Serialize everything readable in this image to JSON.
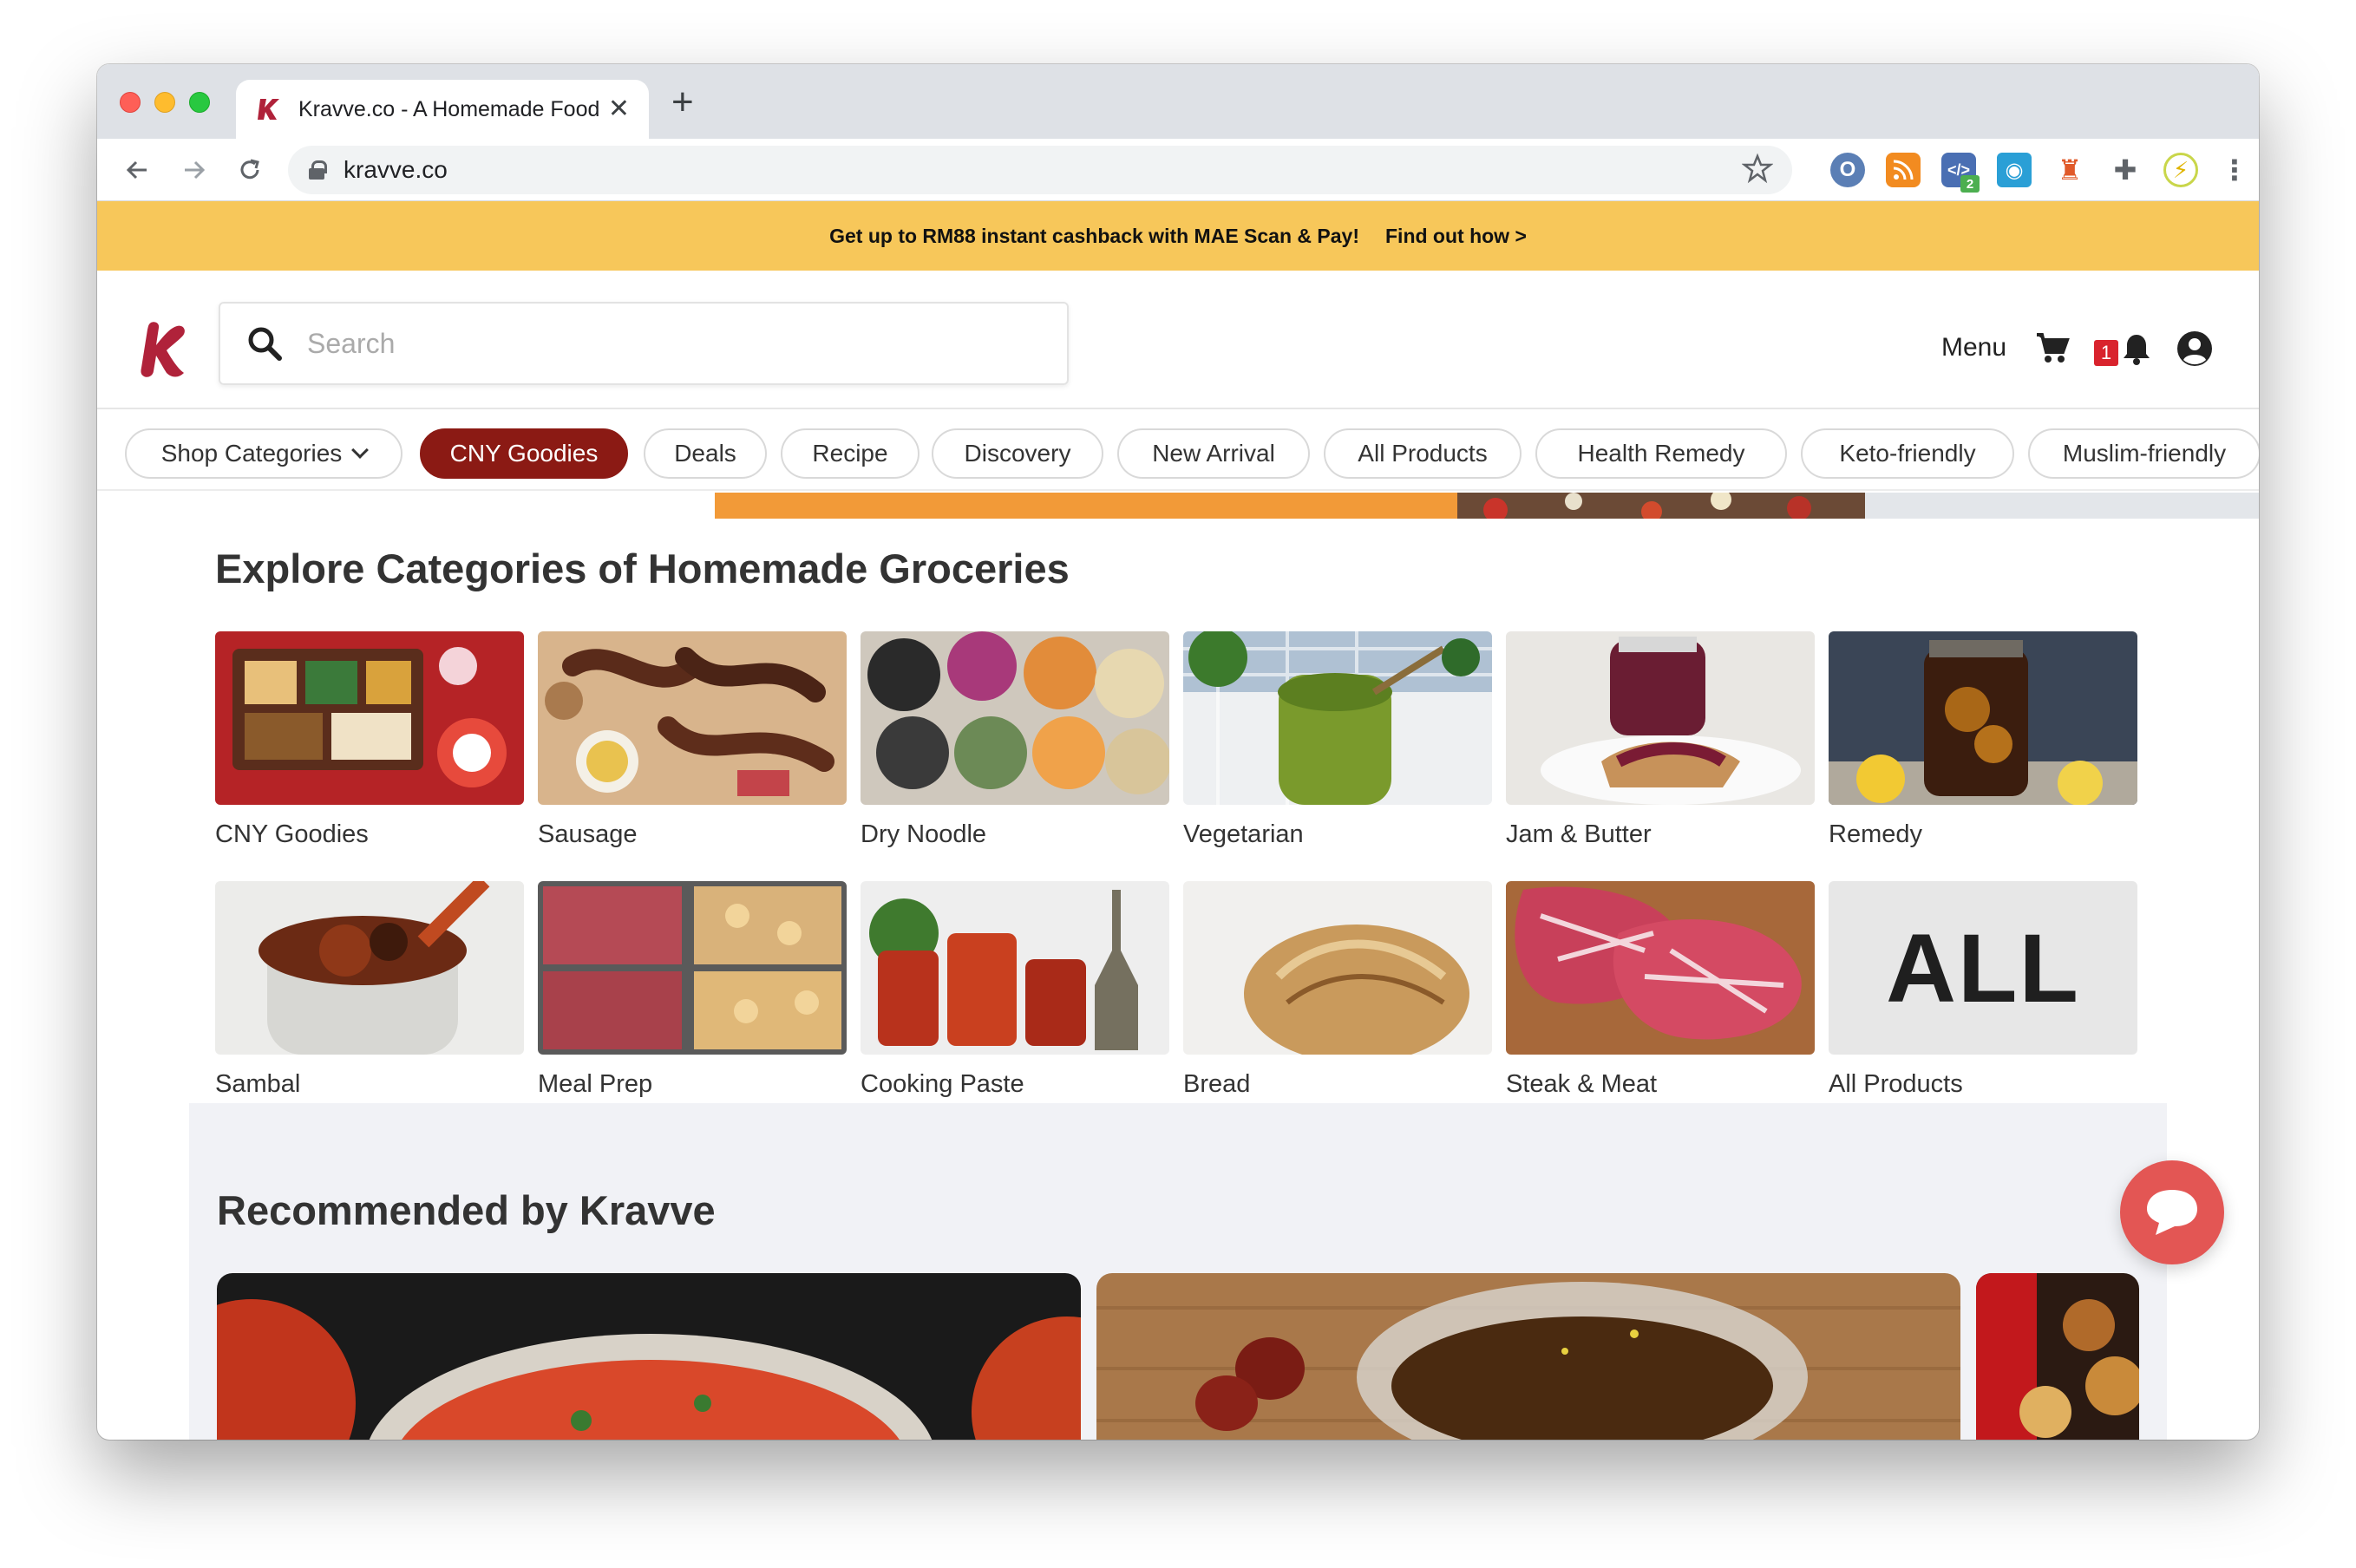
{
  "browser": {
    "tab_title": "Kravve.co - A Homemade Food",
    "tab_close": "✕",
    "new_tab": "+",
    "url": "kravve.co",
    "extension_badge": "2"
  },
  "promo": {
    "text": "Get up to RM88 instant cashback with MAE Scan & Pay!",
    "link": "Find out how >"
  },
  "header": {
    "search_placeholder": "Search",
    "menu_label": "Menu",
    "notification_count": "1"
  },
  "nav_pills": [
    {
      "label": "Shop Categories"
    },
    {
      "label": "CNY Goodies"
    },
    {
      "label": "Deals"
    },
    {
      "label": "Recipe"
    },
    {
      "label": "Discovery"
    },
    {
      "label": "New Arrival"
    },
    {
      "label": "All Products"
    },
    {
      "label": "Health Remedy"
    },
    {
      "label": "Keto-friendly"
    },
    {
      "label": "Muslim-friendly"
    }
  ],
  "explore": {
    "title": "Explore Categories of Homemade Groceries",
    "categories": [
      {
        "label": "CNY Goodies"
      },
      {
        "label": "Sausage"
      },
      {
        "label": "Dry Noodle"
      },
      {
        "label": "Vegetarian"
      },
      {
        "label": "Jam & Butter"
      },
      {
        "label": "Remedy"
      },
      {
        "label": "Sambal"
      },
      {
        "label": "Meal Prep"
      },
      {
        "label": "Cooking Paste"
      },
      {
        "label": "Bread"
      },
      {
        "label": "Steak & Meat"
      },
      {
        "label": "All Products"
      }
    ],
    "all_tile_text": "ALL"
  },
  "recommended": {
    "title": "Recommended by Kravve"
  },
  "colors": {
    "promo_bar": "#f7c75a",
    "active_pill": "#8b1a14",
    "brand": "#b0223a",
    "chat_button": "#e35654",
    "badge": "#d9232d"
  }
}
